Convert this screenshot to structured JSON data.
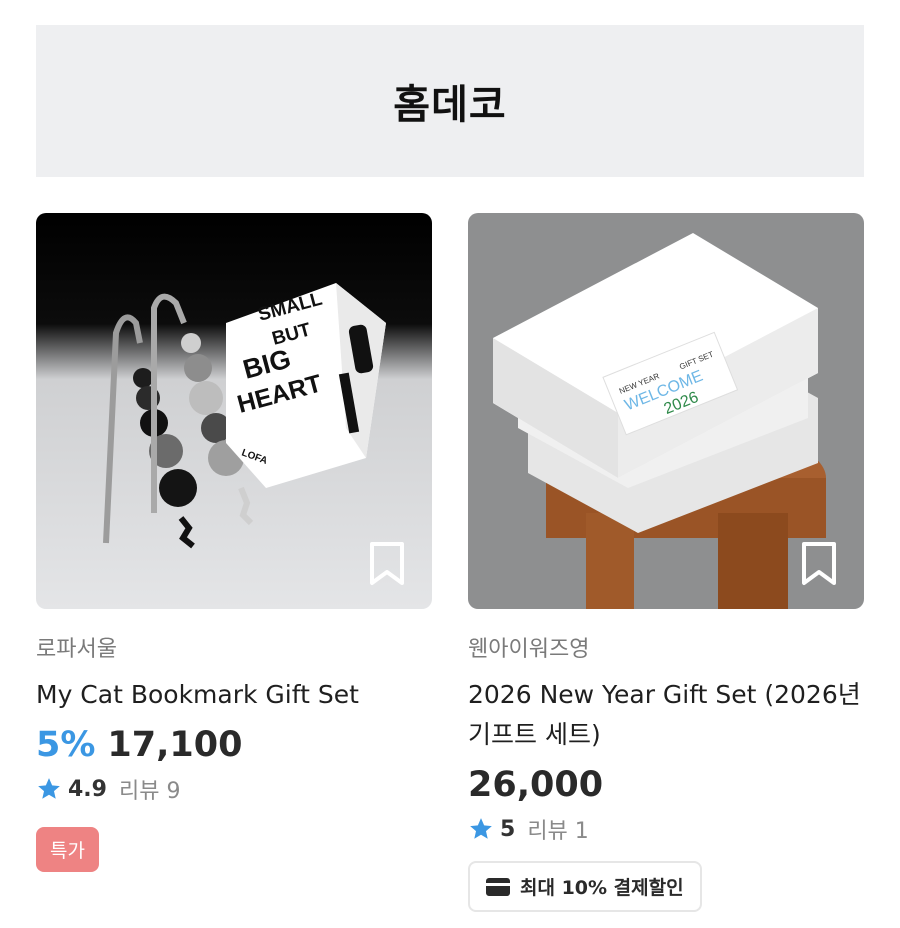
{
  "banner": {
    "title": "홈데코"
  },
  "products": [
    {
      "brand": "로파서울",
      "title": "My Cat Bookmark Gift Set",
      "discount": "5%",
      "price": "17,100",
      "rating": "4.9",
      "reviews": "리뷰 9",
      "badge": "특가",
      "box_text": [
        "SMALL",
        "BUT",
        "BIG",
        "HEART"
      ],
      "box_brand": "LOFA",
      "icon": "bookmark-icon"
    },
    {
      "brand": "웬아이워즈영",
      "title": "2026 New Year Gift Set (2026년 기프트 세트)",
      "price": "26,000",
      "rating": "5",
      "reviews": "리뷰 1",
      "pay_badge": "최대 10% 결제할인",
      "label_top_left": "NEW YEAR",
      "label_top_right": "GIFT SET",
      "label_welcome": "WELCOME",
      "label_year": "2026",
      "icon": "bookmark-icon"
    }
  ],
  "colors": {
    "discount": "#3b97e3",
    "star": "#3b97e3",
    "badge": "#ee8383"
  }
}
